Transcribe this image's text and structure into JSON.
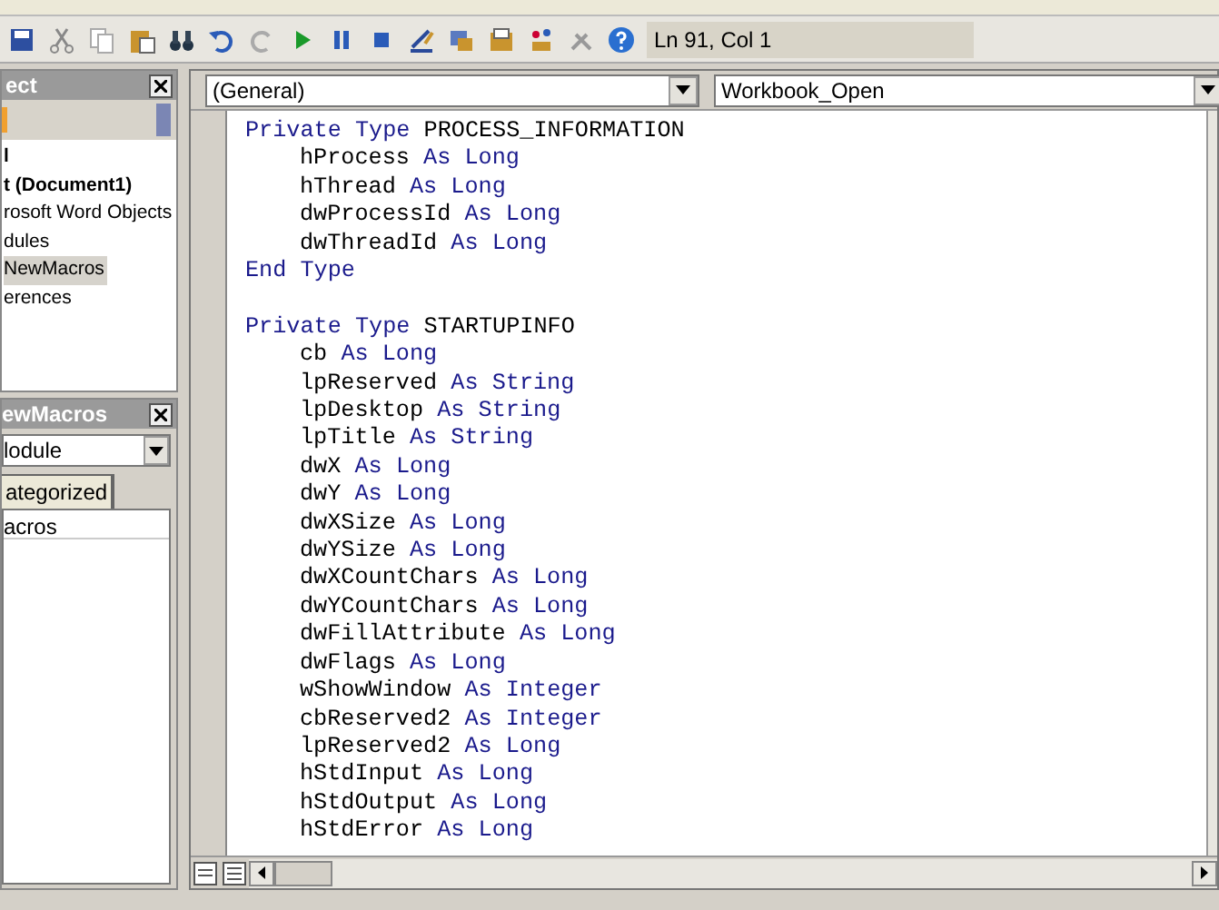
{
  "toolbar": {
    "status": "Ln 91, Col 1"
  },
  "project_panel": {
    "title": "ect",
    "tree": [
      {
        "label": "l",
        "bold": true,
        "selected": false
      },
      {
        "label": "t (Document1)",
        "bold": true,
        "selected": false
      },
      {
        "label": "rosoft Word Objects",
        "bold": false,
        "selected": false
      },
      {
        "label": "dules",
        "bold": false,
        "selected": false
      },
      {
        "label": "NewMacros",
        "bold": false,
        "selected": true
      },
      {
        "label": "erences",
        "bold": false,
        "selected": false
      }
    ]
  },
  "properties_panel": {
    "title": "ewMacros",
    "object_dropdown": "lodule",
    "tabs": [
      {
        "label": "ategorized",
        "selected": true
      }
    ],
    "rows": [
      "acros"
    ]
  },
  "editor": {
    "object_dropdown": "(General)",
    "procedure_dropdown": "Workbook_Open",
    "blocks": [
      {
        "keyword": "Private Type",
        "name": "PROCESS_INFORMATION",
        "members": [
          {
            "name": "hProcess",
            "as": "As",
            "type": "Long"
          },
          {
            "name": "hThread",
            "as": "As",
            "type": "Long"
          },
          {
            "name": "dwProcessId",
            "as": "As",
            "type": "Long"
          },
          {
            "name": "dwThreadId",
            "as": "As",
            "type": "Long"
          }
        ],
        "end": "End Type"
      },
      {
        "keyword": "Private Type",
        "name": "STARTUPINFO",
        "members": [
          {
            "name": "cb",
            "as": "As",
            "type": "Long"
          },
          {
            "name": "lpReserved",
            "as": "As",
            "type": "String"
          },
          {
            "name": "lpDesktop",
            "as": "As",
            "type": "String"
          },
          {
            "name": "lpTitle",
            "as": "As",
            "type": "String"
          },
          {
            "name": "dwX",
            "as": "As",
            "type": "Long"
          },
          {
            "name": "dwY",
            "as": "As",
            "type": "Long"
          },
          {
            "name": "dwXSize",
            "as": "As",
            "type": "Long"
          },
          {
            "name": "dwYSize",
            "as": "As",
            "type": "Long"
          },
          {
            "name": "dwXCountChars",
            "as": "As",
            "type": "Long"
          },
          {
            "name": "dwYCountChars",
            "as": "As",
            "type": "Long"
          },
          {
            "name": "dwFillAttribute",
            "as": "As",
            "type": "Long"
          },
          {
            "name": "dwFlags",
            "as": "As",
            "type": "Long"
          },
          {
            "name": "wShowWindow",
            "as": "As",
            "type": "Integer"
          },
          {
            "name": "cbReserved2",
            "as": "As",
            "type": "Integer"
          },
          {
            "name": "lpReserved2",
            "as": "As",
            "type": "Long"
          },
          {
            "name": "hStdInput",
            "as": "As",
            "type": "Long"
          },
          {
            "name": "hStdOutput",
            "as": "As",
            "type": "Long"
          },
          {
            "name": "hStdError",
            "as": "As",
            "type": "Long"
          }
        ]
      }
    ]
  }
}
